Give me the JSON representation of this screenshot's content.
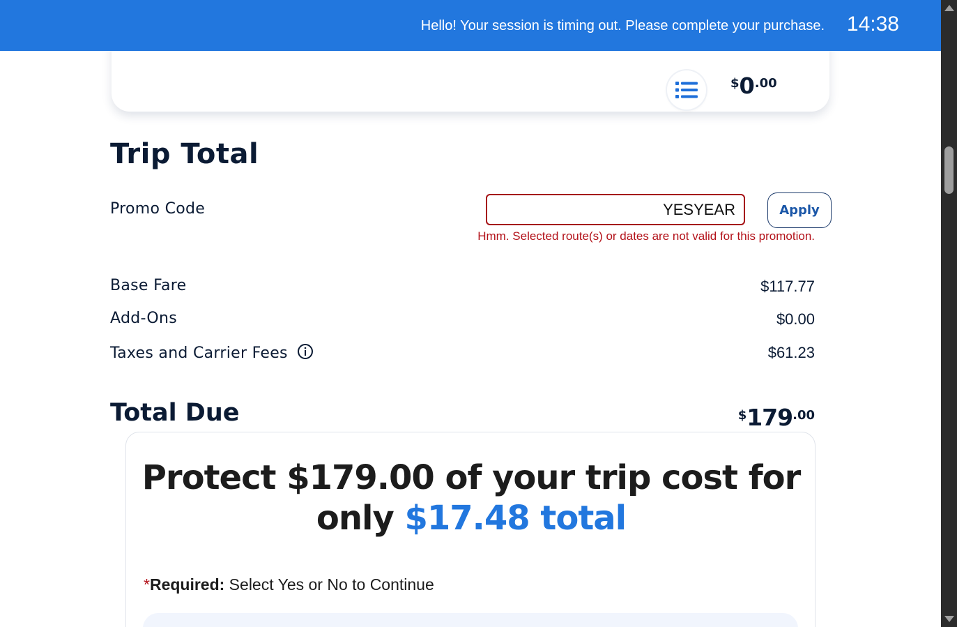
{
  "banner": {
    "message": "Hello! Your session is timing out. Please complete your purchase.",
    "timer": "14:38"
  },
  "top_card": {
    "icon": "list-icon",
    "price_currency": "$",
    "price_whole": "0",
    "price_cents": ".00"
  },
  "trip_total": {
    "title": "Trip Total",
    "promo_label": "Promo Code",
    "promo_value": "YESYEAR",
    "apply_label": "Apply",
    "promo_error": "Hmm. Selected route(s) or dates are not valid for this promotion.",
    "rows": [
      {
        "label": "Base Fare",
        "value": "$117.77"
      },
      {
        "label": "Add-Ons",
        "value": "$0.00"
      },
      {
        "label": "Taxes and Carrier Fees",
        "value": "$61.23",
        "icon": "info-icon"
      }
    ],
    "total_label": "Total Due",
    "total_currency": "$",
    "total_whole": "179",
    "total_cents": ".00"
  },
  "protection": {
    "headline_part1": "Protect $179.00 of your trip cost for only ",
    "headline_highlight": "$17.48 total",
    "required_star": "*",
    "required_bold": "Required:",
    "required_text": " Select Yes or No to Continue"
  },
  "colors": {
    "banner_bg": "#2277de",
    "error": "#b3121a",
    "highlight": "#2277de",
    "text_dark": "#0b1b34"
  }
}
